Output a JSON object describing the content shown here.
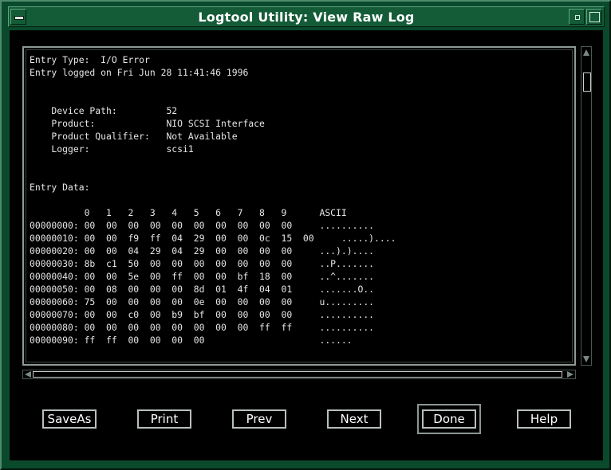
{
  "window": {
    "title": "Logtool Utility: View Raw Log"
  },
  "log": {
    "lines": [
      "Entry Type:  I/O Error",
      "Entry logged on Fri Jun 28 11:41:46 1996",
      "",
      "",
      "    Device Path:         52",
      "    Product:             NIO SCSI Interface",
      "    Product Qualifier:   Not Available",
      "    Logger:              scsi1",
      "",
      "",
      "Entry Data:",
      "",
      "          0   1   2   3   4   5   6   7   8   9      ASCII",
      "00000000: 00  00  00  00  00  00  00  00  00  00     ..........",
      "00000010: 00  00  f9  ff  04  29  00  00  0c  15  00     .....)....",
      "00000020: 00  00  04  29  04  29  00  00  00  00     ...).)....",
      "00000030: 8b  c1  50  00  00  00  00  00  00  00     ..P.......",
      "00000040: 00  00  5e  00  ff  00  00  bf  18  00     ..^.......",
      "00000050: 00  08  00  00  00  8d  01  4f  04  01     .......O..",
      "00000060: 75  00  00  00  00  0e  00  00  00  00     u.........",
      "00000070: 00  00  c0  00  b9  bf  00  00  00  00     ..........",
      "00000080: 00  00  00  00  00  00  00  00  ff  ff     ..........",
      "00000090: ff  ff  00  00  00  00                     ......"
    ]
  },
  "buttons": {
    "saveas": "SaveAs",
    "print": "Print",
    "prev": "Prev",
    "next": "Next",
    "done": "Done",
    "help": "Help"
  }
}
